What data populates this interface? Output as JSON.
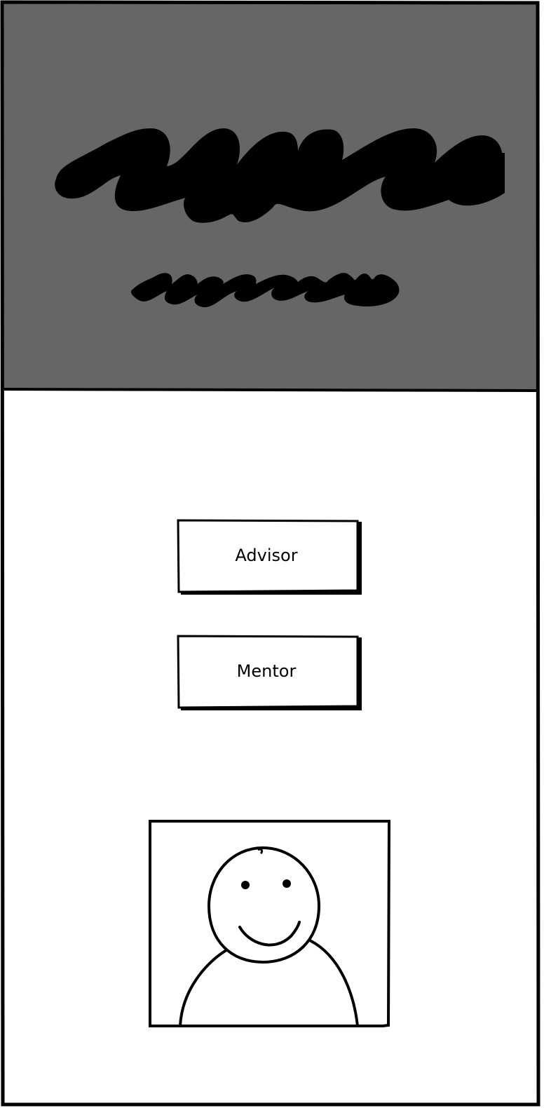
{
  "actions": {
    "advisor_label": "Advisor",
    "mentor_label": "Mentor"
  },
  "header": {
    "background_color": "#666666",
    "title_scribble": "redacted-title-scribble",
    "subtitle_scribble": "redacted-subtitle-scribble"
  },
  "profile": {
    "avatar_icon": "user-avatar-icon"
  }
}
